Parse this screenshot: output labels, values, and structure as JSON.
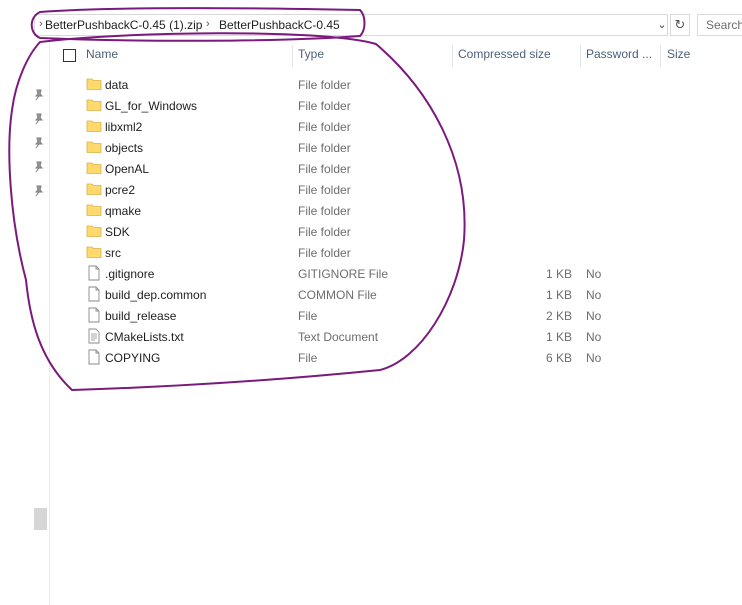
{
  "address_bar": {
    "crumbs": [
      "BetterPushbackC-0.45 (1).zip",
      "BetterPushbackC-0.45"
    ],
    "search_placeholder": "Search"
  },
  "columns": {
    "name": "Name",
    "type": "Type",
    "compressed_size": "Compressed size",
    "password": "Password ...",
    "size": "Size"
  },
  "files": [
    {
      "name": "data",
      "type": "File folder",
      "compressed_size": "",
      "password": "",
      "icon": "folder-icon"
    },
    {
      "name": "GL_for_Windows",
      "type": "File folder",
      "compressed_size": "",
      "password": "",
      "icon": "folder-icon"
    },
    {
      "name": "libxml2",
      "type": "File folder",
      "compressed_size": "",
      "password": "",
      "icon": "folder-icon"
    },
    {
      "name": "objects",
      "type": "File folder",
      "compressed_size": "",
      "password": "",
      "icon": "folder-icon"
    },
    {
      "name": "OpenAL",
      "type": "File folder",
      "compressed_size": "",
      "password": "",
      "icon": "folder-icon"
    },
    {
      "name": "pcre2",
      "type": "File folder",
      "compressed_size": "",
      "password": "",
      "icon": "folder-icon"
    },
    {
      "name": "qmake",
      "type": "File folder",
      "compressed_size": "",
      "password": "",
      "icon": "folder-icon"
    },
    {
      "name": "SDK",
      "type": "File folder",
      "compressed_size": "",
      "password": "",
      "icon": "folder-icon"
    },
    {
      "name": "src",
      "type": "File folder",
      "compressed_size": "",
      "password": "",
      "icon": "folder-icon"
    },
    {
      "name": ".gitignore",
      "type": "GITIGNORE File",
      "compressed_size": "1 KB",
      "password": "No",
      "icon": "file-icon"
    },
    {
      "name": "build_dep.common",
      "type": "COMMON File",
      "compressed_size": "1 KB",
      "password": "No",
      "icon": "file-icon"
    },
    {
      "name": "build_release",
      "type": "File",
      "compressed_size": "2 KB",
      "password": "No",
      "icon": "file-icon"
    },
    {
      "name": "CMakeLists.txt",
      "type": "Text Document",
      "compressed_size": "1 KB",
      "password": "No",
      "icon": "text-document-icon"
    },
    {
      "name": "COPYING",
      "type": "File",
      "compressed_size": "6 KB",
      "password": "No",
      "icon": "file-icon"
    }
  ],
  "colors": {
    "folder": "#ffd96b",
    "annotation": "#7a1a7c",
    "header_text": "#4c607a"
  }
}
